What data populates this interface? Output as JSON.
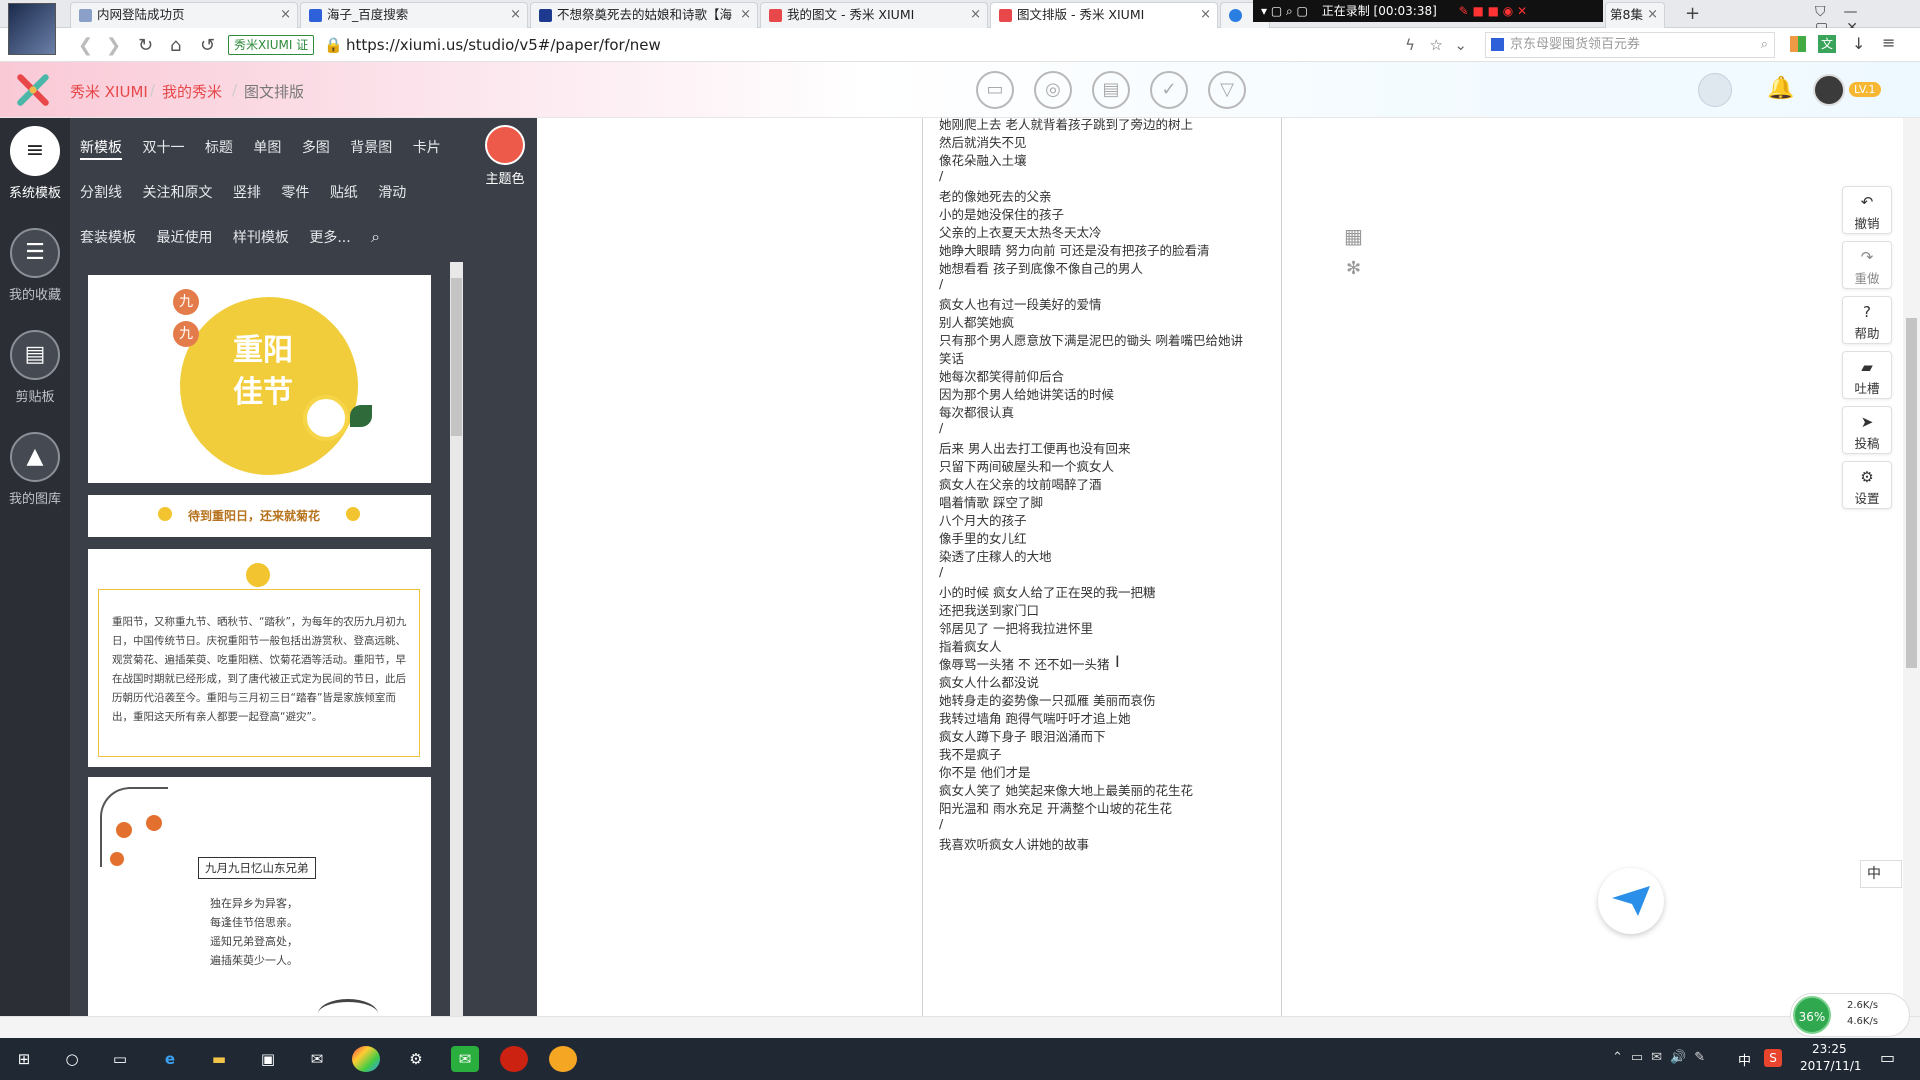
{
  "browser": {
    "tabs": [
      {
        "label": "内网登陆成功页",
        "icon": "page-icon",
        "color": "#8aa0c8"
      },
      {
        "label": "海子_百度搜索",
        "icon": "baidu-icon",
        "color": "#2e61d9"
      },
      {
        "label": "不想祭奠死去的姑娘和诗歌【海",
        "icon": "blog-icon",
        "color": "#1d3a8f"
      },
      {
        "label": "我的图文 - 秀米 XIUMI",
        "icon": "xiumi-icon",
        "color": "#e8484a"
      },
      {
        "label": "图文排版 - 秀米 XIUMI",
        "icon": "xiumi-icon",
        "color": "#e8484a"
      },
      {
        "label": "第8集",
        "icon": "page-icon",
        "color": "#999999"
      }
    ],
    "recording": "正在录制 [00:03:38]",
    "site_badge": "秀米XIUMI",
    "verified": "证",
    "url": "https://xiumi.us/studio/v5#/paper/for/new",
    "search_placeholder": "京东母婴囤货领百元券",
    "new_tab": "+"
  },
  "app": {
    "brand": "秀米 XIUMI",
    "crumbs": [
      "我的秀米",
      "图文排版"
    ],
    "level": "LV.1",
    "accent": "#e8484a"
  },
  "sidebar": {
    "items": [
      {
        "label": "系统模板",
        "icon": "menu-icon"
      },
      {
        "label": "我的收藏",
        "icon": "favorites-icon"
      },
      {
        "label": "剪贴板",
        "icon": "clipboard-icon"
      },
      {
        "label": "我的图库",
        "icon": "gallery-icon"
      }
    ]
  },
  "panel": {
    "row1": [
      "新模板",
      "双十一",
      "标题",
      "单图",
      "多图",
      "背景图",
      "卡片"
    ],
    "row2": [
      "分割线",
      "关注和原文",
      "竖排",
      "零件",
      "贴纸",
      "滑动"
    ],
    "row3": [
      "套装模板",
      "最近使用",
      "样刊模板",
      "更多..."
    ],
    "theme_label": "主题色",
    "theme_color": "#ee5a49"
  },
  "templates": {
    "card1_char": "九",
    "card1_title_line1": "重阳",
    "card1_title_line2": "佳节",
    "card2_text": "待到重阳日，还来就菊花",
    "card3_text": "重阳节，又称重九节、晒秋节、“踏秋”，为每年的农历九月初九日，中国传统节日。庆祝重阳节一般包括出游赏秋、登高远眺、观赏菊花、遍插茱萸、吃重阳糕、饮菊花酒等活动。重阳节，早在战国时期就已经形成，到了唐代被正式定为民间的节日，此后历朝历代沿袭至今。重阳与三月初三日“踏春”皆是家族倾室而出，重阳这天所有亲人都要一起登高“避灾”。",
    "card4_title": "九月九日忆山东兄弟",
    "card4_poem": [
      "独在异乡为异客，",
      "每逢佳节倍思亲。",
      "遥知兄弟登高处，",
      "遍插茱萸少一人。"
    ]
  },
  "article": {
    "lines": [
      "她刚爬上去 老人就背着孩子跳到了旁边的树上",
      "然后就消失不见",
      "像花朵融入土壤",
      "/",
      "老的像她死去的父亲",
      "小的是她没保住的孩子",
      "父亲的上衣夏天太热冬天太冷",
      "她睁大眼睛 努力向前 可还是没有把孩子的脸看清",
      "她想看看 孩子到底像不像自己的男人",
      "/",
      "疯女人也有过一段美好的爱情",
      "别人都笑她疯",
      "只有那个男人愿意放下满是泥巴的锄头 咧着嘴巴给她讲",
      "笑话",
      "她每次都笑得前仰后合",
      "因为那个男人给她讲笑话的时候",
      "每次都很认真",
      "/",
      "后来 男人出去打工便再也没有回来",
      "只留下两间破屋头和一个疯女人",
      "疯女人在父亲的坟前喝醉了酒",
      "唱着情歌 踩空了脚",
      "八个月大的孩子",
      "像手里的女儿红",
      "染透了庄稼人的大地",
      "/",
      "小的时候 疯女人给了正在哭的我一把糖",
      "还把我送到家门口",
      "邻居见了 一把将我拉进怀里",
      "指着疯女人",
      "像辱骂一头猪 不 还不如一头猪",
      "疯女人什么都没说",
      "她转身走的姿势像一只孤雁 美丽而哀伤",
      "我转过墙角 跑得气喘吁吁才追上她",
      "疯女人蹲下身子 眼泪汹涌而下",
      "我不是疯子",
      "你不是 他们才是",
      "疯女人笑了 她笑起来像大地上最美丽的花生花",
      "阳光温和 雨水充足 开满整个山坡的花生花",
      "/",
      "我喜欢听疯女人讲她的故事"
    ]
  },
  "right_tools": [
    {
      "label": "撤销",
      "icon": "undo-icon",
      "glyph": "↶"
    },
    {
      "label": "重做",
      "icon": "redo-icon",
      "glyph": "↷"
    },
    {
      "label": "帮助",
      "icon": "help-icon",
      "glyph": "?"
    },
    {
      "label": "吐槽",
      "icon": "comment-icon",
      "glyph": "▰"
    },
    {
      "label": "投稿",
      "icon": "send-icon",
      "glyph": "➤"
    },
    {
      "label": "设置",
      "icon": "gear-icon",
      "glyph": "⚙"
    }
  ],
  "ime": {
    "label": "中"
  },
  "netmon": {
    "percent": "36%",
    "up": "2.6K/s",
    "down": "4.6K/s"
  },
  "taskbar": {
    "time": "23:25",
    "date": "2017/11/1",
    "ime": "中"
  }
}
